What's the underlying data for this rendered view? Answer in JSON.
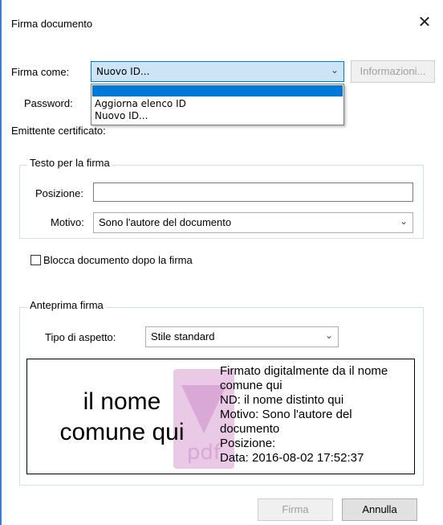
{
  "window": {
    "title": "Firma documento"
  },
  "sign_as": {
    "label": "Firma come:",
    "value": "Nuovo ID...",
    "info_button": "Informazioni..."
  },
  "dropdown": {
    "items": [
      "Aggiorna elenco ID",
      "Nuovo ID..."
    ]
  },
  "password": {
    "label": "Password:"
  },
  "issuer": {
    "label": "Emittente certificato:"
  },
  "text_group": {
    "title": "Testo per la firma",
    "position_label": "Posizione:",
    "position_value": "",
    "reason_label": "Motivo:",
    "reason_value": "Sono l'autore del documento"
  },
  "lock": {
    "label": "Blocca documento dopo la firma",
    "checked": false
  },
  "preview_group": {
    "title": "Anteprima firma",
    "appearance_label": "Tipo di aspetto:",
    "appearance_value": "Stile standard"
  },
  "signature_preview": {
    "name_line1": "il nome",
    "name_line2": "comune qui",
    "details": [
      "Firmato digitalmente da il nome",
      "comune qui",
      "ND: il nome distinto qui",
      "Motivo: Sono l'autore del",
      "documento",
      "Posizione:",
      "Data: 2016-08-02 17:52:37"
    ],
    "watermark_color": "#d9a8d6"
  },
  "buttons": {
    "sign": "Firma",
    "cancel": "Annulla"
  },
  "colors": {
    "selection": "#0078d7",
    "combo_focus": "#cce4f7"
  }
}
